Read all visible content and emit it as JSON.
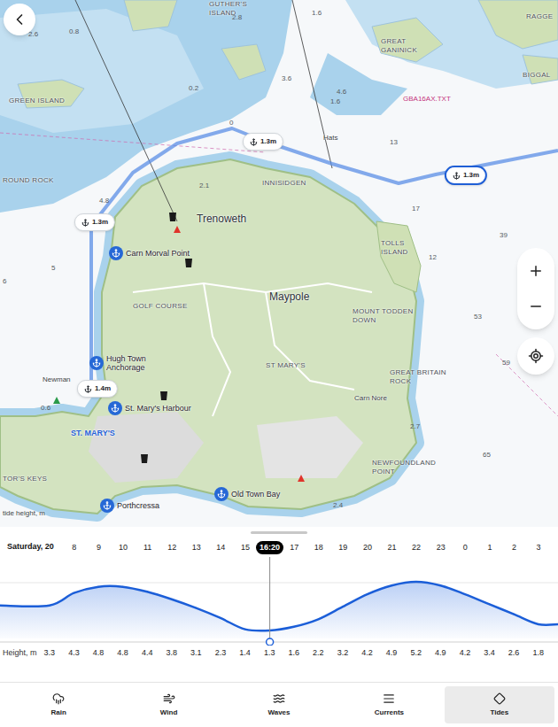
{
  "map": {
    "labels": [
      {
        "text": "GUTHER'S ISLAND",
        "kind": "place"
      },
      {
        "text": "GREAT GANINICK",
        "kind": "place"
      },
      {
        "text": "RAGGE",
        "kind": "place"
      },
      {
        "text": "BIGGAL",
        "kind": "place"
      },
      {
        "text": "GREEN ISLAND",
        "kind": "place"
      },
      {
        "text": "ROUND ROCK",
        "kind": "place"
      },
      {
        "text": "INNISIDGEN",
        "kind": "place"
      },
      {
        "text": "Trenoweth",
        "kind": "area"
      },
      {
        "text": "Maypole",
        "kind": "area"
      },
      {
        "text": "GOLF COURSE",
        "kind": "place"
      },
      {
        "text": "ST MARY'S",
        "kind": "place"
      },
      {
        "text": "MOUNT TODDEN DOWN",
        "kind": "place"
      },
      {
        "text": "GREAT BRITAIN ROCK",
        "kind": "place"
      },
      {
        "text": "Carn Nore",
        "kind": "small"
      },
      {
        "text": "NEWFOUNDLAND POINT",
        "kind": "place"
      },
      {
        "text": "TOLLS ISLAND",
        "kind": "place"
      },
      {
        "text": "GBA16AX.TXT",
        "kind": "code"
      },
      {
        "text": "Hats",
        "kind": "small"
      },
      {
        "text": "Newman",
        "kind": "small"
      },
      {
        "text": "ST. MARY'S",
        "kind": "town"
      },
      {
        "text": "TOR'S KEYS",
        "kind": "place"
      },
      {
        "text": "tide height, m",
        "kind": "small"
      }
    ],
    "depths": [
      "2.6",
      "0.8",
      "1.6",
      "3.6",
      "4.6",
      "1.6",
      "13",
      "17",
      "39",
      "12",
      "53",
      "59",
      "65",
      "5",
      "4.8",
      "2.1",
      "2.7",
      "2.4",
      "0.6",
      "2.8",
      "0",
      "6",
      "0.2"
    ],
    "anchorages": [
      {
        "name": "Carn Morval Point"
      },
      {
        "name": "Hugh Town Anchorage"
      },
      {
        "name": "St. Mary's Harbour"
      },
      {
        "name": "Porthcressa"
      },
      {
        "name": "Old Town Bay"
      }
    ],
    "route_badges": [
      {
        "text": "1.3m",
        "selected": false
      },
      {
        "text": "1.3m",
        "selected": false
      },
      {
        "text": "1.3m",
        "selected": true
      },
      {
        "text": "1.4m",
        "selected": false
      }
    ]
  },
  "timeline": {
    "day": "Saturday, 20",
    "hours": [
      {
        "label": "8",
        "selected": false
      },
      {
        "label": "9",
        "selected": false
      },
      {
        "label": "10",
        "selected": false
      },
      {
        "label": "11",
        "selected": false
      },
      {
        "label": "12",
        "selected": false
      },
      {
        "label": "13",
        "selected": false
      },
      {
        "label": "14",
        "selected": false
      },
      {
        "label": "15",
        "selected": false
      },
      {
        "label": "16:20",
        "selected": true
      },
      {
        "label": "17",
        "selected": false
      },
      {
        "label": "18",
        "selected": false
      },
      {
        "label": "19",
        "selected": false
      },
      {
        "label": "20",
        "selected": false
      },
      {
        "label": "21",
        "selected": false
      },
      {
        "label": "22",
        "selected": false
      },
      {
        "label": "23",
        "selected": false
      },
      {
        "label": "0",
        "selected": false
      },
      {
        "label": "1",
        "selected": false
      },
      {
        "label": "2",
        "selected": false
      },
      {
        "label": "3",
        "selected": false
      }
    ]
  },
  "tide_chart": {
    "axis_label": "Height, m",
    "heights": [
      "3.3",
      "4.3",
      "4.8",
      "4.8",
      "4.4",
      "3.8",
      "3.1",
      "2.3",
      "1.4",
      "1.3",
      "1.6",
      "2.2",
      "3.2",
      "4.2",
      "4.9",
      "5.2",
      "4.9",
      "4.2",
      "3.4",
      "2.6",
      "1.8"
    ],
    "series": [
      3.3,
      4.3,
      4.8,
      4.8,
      4.4,
      3.8,
      3.1,
      2.3,
      1.4,
      1.3,
      1.6,
      2.2,
      3.2,
      4.2,
      4.9,
      5.2,
      4.9,
      4.2,
      3.4,
      2.6,
      1.8
    ]
  },
  "tabs": [
    {
      "label": "Rain",
      "selected": false
    },
    {
      "label": "Wind",
      "selected": false
    },
    {
      "label": "Waves",
      "selected": false
    },
    {
      "label": "Currents",
      "selected": false
    },
    {
      "label": "Tides",
      "selected": true
    }
  ]
}
